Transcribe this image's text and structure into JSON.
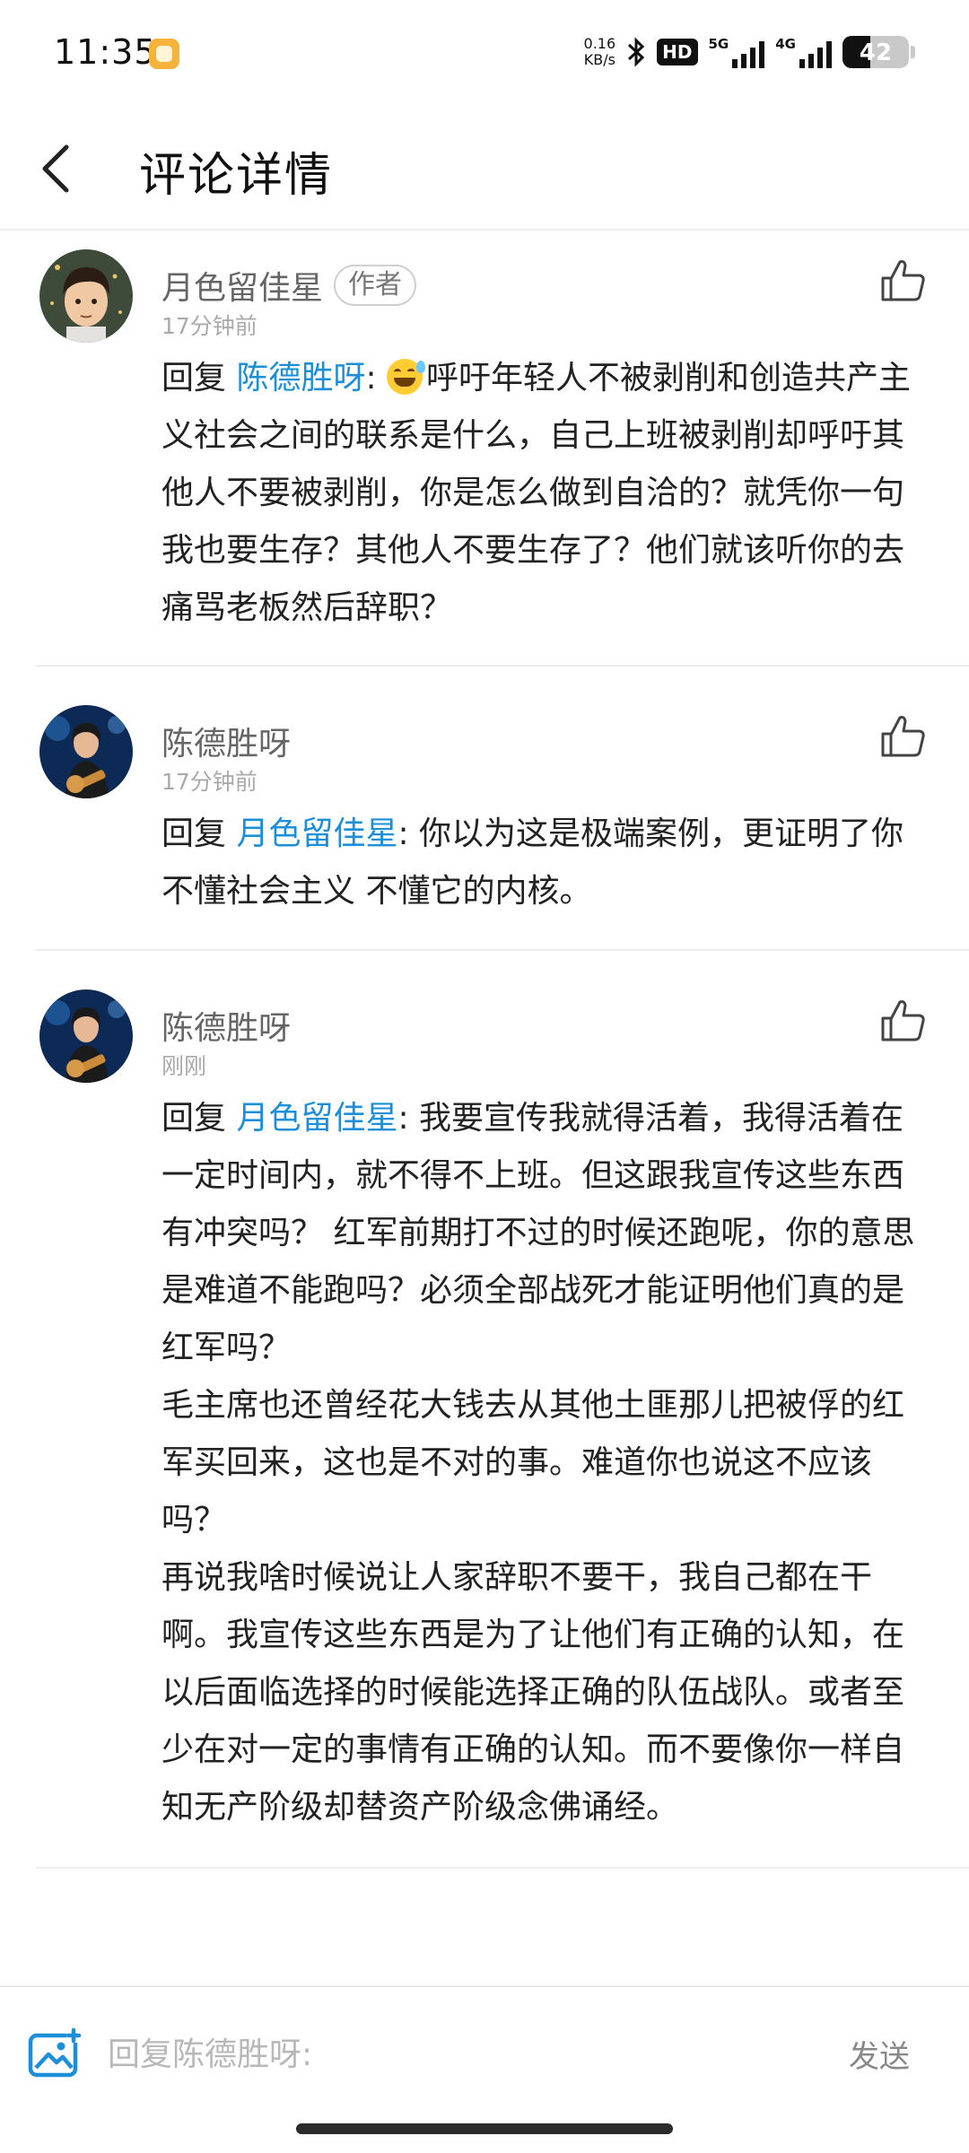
{
  "status_bar": {
    "time": "11:35",
    "net_speed_value": "0.16",
    "net_speed_unit": "KB/s",
    "hd_label": "HD",
    "signal_1_label": "5G",
    "signal_2_label": "4G",
    "battery_level": "42",
    "battery_fraction": 0.42
  },
  "header": {
    "title": "评论详情"
  },
  "comments": [
    {
      "author": "月色留佳星",
      "tag": "作者",
      "time": "17分钟前",
      "reply_prefix": "回复 ",
      "mention": "陈德胜呀",
      "emoji": "grinning-sweat-emoji",
      "text_after_mention": ": ",
      "text": "呼吁年轻人不被剥削和创造共产主义社会之间的联系是什么，自己上班被剥削却呼吁其他人不要被剥削，你是怎么做到自洽的？就凭你一句我也要生存？其他人不要生存了？他们就该听你的去痛骂老板然后辞职？"
    },
    {
      "author": "陈德胜呀",
      "time": "17分钟前",
      "reply_prefix": "回复 ",
      "mention": "月色留佳星",
      "text": ": 你以为这是极端案例，更证明了你不懂社会主义 不懂它的内核。"
    },
    {
      "author": "陈德胜呀",
      "time": "刚刚",
      "reply_prefix": "回复 ",
      "mention": "月色留佳星",
      "text": ": 我要宣传我就得活着，我得活着在一定时间内，就不得不上班。但这跟我宣传这些东西有冲突吗？ 红军前期打不过的时候还跑呢，你的意思是难道不能跑吗？必须全部战死才能证明他们真的是红军吗？\n毛主席也还曾经花大钱去从其他土匪那儿把被俘的红军买回来，这也是不对的事。难道你也说这不应该吗？\n再说我啥时候说让人家辞职不要干，我自己都在干啊。我宣传这些东西是为了让他们有正确的认知，在以后面临选择的时候能选择正确的队伍战队。或者至少在对一定的事情有正确的认知。而不要像你一样自知无产阶级却替资产阶级念佛诵经。"
    }
  ],
  "input_bar": {
    "placeholder": "回复陈德胜呀:",
    "value": "",
    "send_label": "发送",
    "image_icon": "image-icon"
  },
  "colors": {
    "mention": "#1d8fd8",
    "accent_icon": "#1d8fd8"
  }
}
